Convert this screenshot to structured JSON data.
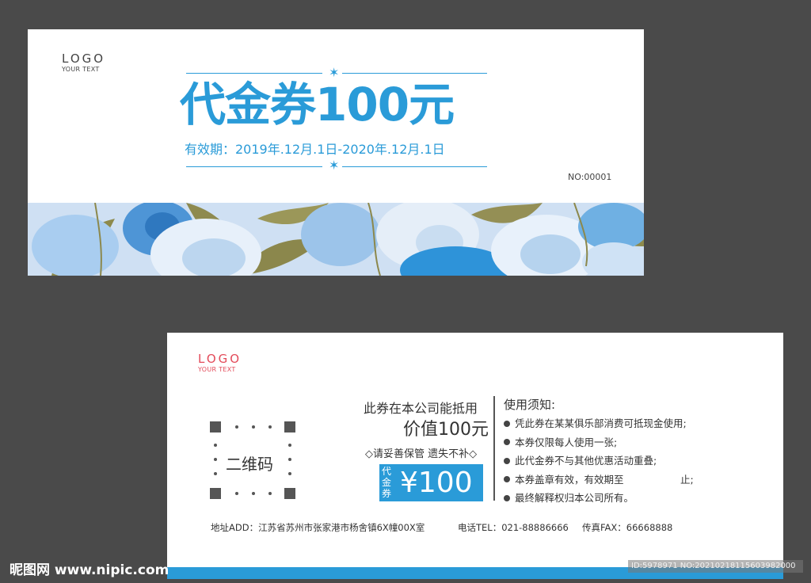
{
  "front": {
    "logo": {
      "text": "LOGO",
      "sub": "YOUR TEXT"
    },
    "title": "代金券100元",
    "validity": "有效期：2019年.12月.1日-2020年.12月.1日",
    "serial": "NO:00001"
  },
  "back": {
    "logo": {
      "text": "LOGO",
      "sub": "YOUR TEXT"
    },
    "qr_label": "二维码",
    "usage": "此券在本公司能抵用",
    "value": "价值100元",
    "keep_note": "◇请妥善保管 遗失不补◇",
    "price_label": "代金券",
    "price_amount": "¥100",
    "rules_title": "使用须知:",
    "rules": [
      "凭此券在某某俱乐部消费可抵现金使用;",
      "本券仅限每人使用一张;",
      "此代金券不与其他优惠活动重叠;",
      "本券盖章有效，有效期至                  止;",
      "最终解释权归本公司所有。"
    ],
    "address": "地址ADD：江苏省苏州市张家港市杨舍镇6X幢00X室",
    "phone": "电话TEL：021-88886666",
    "fax": "传真FAX：66668888"
  },
  "watermark": {
    "site": "昵图网 www.nipic.com",
    "id": "ID:5978971 NO:20210218115603982000"
  },
  "colors": {
    "accent": "#2a9bd8",
    "background": "#4a4a4a",
    "logo_back": "#e34b5a"
  }
}
